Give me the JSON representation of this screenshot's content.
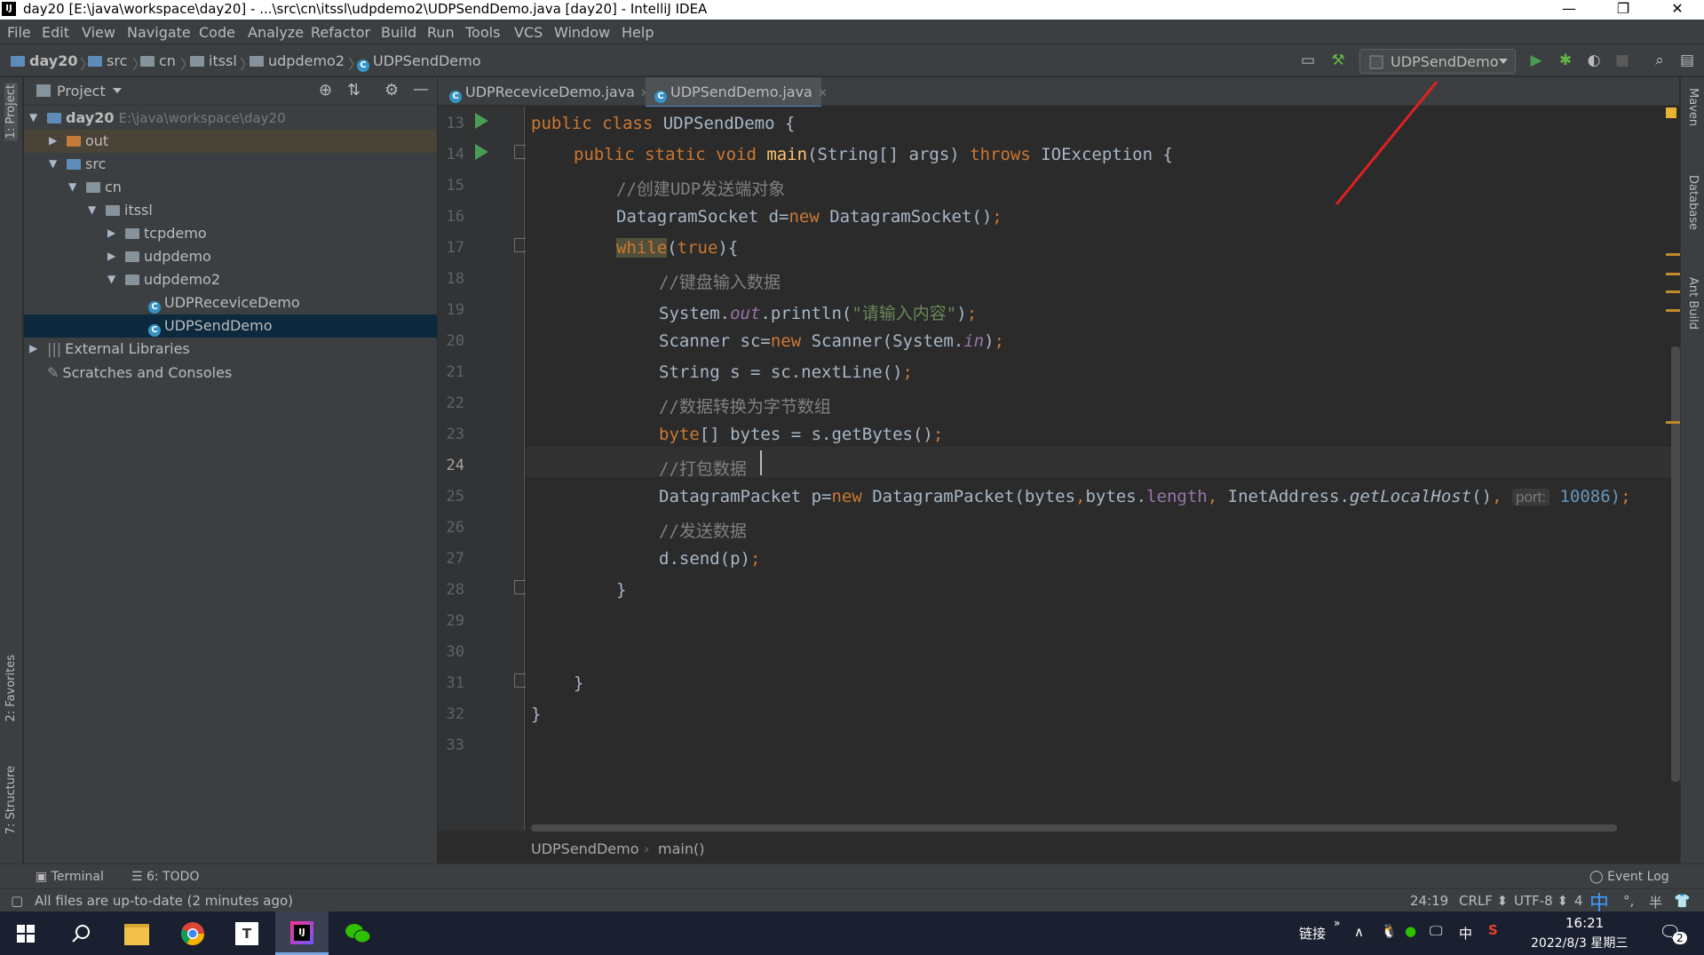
{
  "window": {
    "title": "day20 [E:\\java\\workspace\\day20] - ...\\src\\cn\\itssl\\udpdemo2\\UDPSendDemo.java [day20] - IntelliJ IDEA",
    "logo_text": "IJ",
    "minimize": "—",
    "restore": "❐",
    "close": "✕"
  },
  "menu": [
    "File",
    "Edit",
    "View",
    "Navigate",
    "Code",
    "Analyze",
    "Refactor",
    "Build",
    "Run",
    "Tools",
    "VCS",
    "Window",
    "Help"
  ],
  "navbar": {
    "crumbs": [
      "day20",
      "src",
      "cn",
      "itssl",
      "udpdemo2",
      "UDPSendDemo"
    ],
    "run_config": "UDPSendDemo"
  },
  "left_strip": {
    "project": "1: Project",
    "favorites": "2: Favorites",
    "structure": "7: Structure"
  },
  "right_strip": {
    "maven": "Maven",
    "database": "Database",
    "ant": "Ant Build"
  },
  "project_panel": {
    "title": "Project",
    "tree": [
      {
        "label": "day20",
        "path": "E:\\java\\workspace\\day20"
      },
      {
        "label": "out"
      },
      {
        "label": "src"
      },
      {
        "label": "cn"
      },
      {
        "label": "itssl"
      },
      {
        "label": "tcpdemo"
      },
      {
        "label": "udpdemo"
      },
      {
        "label": "udpdemo2"
      },
      {
        "label": "UDPReceviceDemo"
      },
      {
        "label": "UDPSendDemo"
      },
      {
        "label": "External Libraries"
      },
      {
        "label": "Scratches and Consoles"
      }
    ]
  },
  "tabs": [
    {
      "label": "UDPReceviceDemo.java"
    },
    {
      "label": "UDPSendDemo.java"
    }
  ],
  "editor": {
    "line_numbers": [
      "13",
      "14",
      "15",
      "16",
      "17",
      "18",
      "19",
      "20",
      "21",
      "22",
      "23",
      "24",
      "25",
      "26",
      "27",
      "28",
      "29",
      "30",
      "31",
      "32",
      "33"
    ],
    "current_line": "24",
    "t": {
      "l13a": "public class ",
      "l13b": "UDPSendDemo {",
      "l14a": "public static void ",
      "l14b": "main",
      "l14c": "(String[] args) ",
      "l14d": "throws ",
      "l14e": "IOException {",
      "l15": "//创建UDP发送端对象",
      "l16a": "DatagramSocket d=",
      "l16b": "new ",
      "l16c": "DatagramSocket()",
      "l16d": ";",
      "l17a": "while",
      "l17b": "(",
      "l17c": "true",
      "l17d": "){",
      "l18": "//键盘输入数据",
      "l19a": "System.",
      "l19b": "out",
      "l19c": ".println(",
      "l19d": "\"请输入内容\"",
      "l19e": ")",
      "l19f": ";",
      "l20a": "Scanner sc=",
      "l20b": "new ",
      "l20c": "Scanner(System.",
      "l20d": "in",
      "l20e": ")",
      "l20f": ";",
      "l21a": "String s = sc.nextLine()",
      "l21b": ";",
      "l22": "//数据转换为字节数组",
      "l23a": "byte",
      "l23b": "[] bytes = s.getBytes()",
      "l23c": ";",
      "l24": "//打包数据",
      "l25a": "DatagramPacket p=",
      "l25b": "new ",
      "l25c": "DatagramPacket(bytes",
      "l25d": ",",
      "l25e": "bytes.",
      "l25f": "length",
      "l25g": ", ",
      "l25h": "InetAddress.",
      "l25i": "getLocalHost",
      "l25j": "()",
      "l25k": ", ",
      "l25hint": "port:",
      "l25l": " 10086)",
      "l25m": ";",
      "l26": "//发送数据",
      "l27a": "d.send(p)",
      "l27b": ";",
      "l28": "}",
      "l31": "}",
      "l32": "}"
    }
  },
  "editor_breadcrumb": [
    "UDPSendDemo",
    "main()"
  ],
  "bottom_tabs": {
    "terminal": "Terminal",
    "todo": "6: TODO",
    "event_log": "Event Log"
  },
  "status": {
    "message": "All files are up-to-date (2 minutes ago)",
    "position": "24:19",
    "line_sep": "CRLF",
    "encoding": "UTF-8",
    "indent": "4"
  },
  "taskbar": {
    "link": "链接",
    "ime": "中",
    "time": "16:21",
    "date": "2022/8/3 星期三",
    "notifications": "2",
    "tray_extra": "半"
  },
  "colors": {
    "accent": "#4a88c7",
    "run_green": "#499c54",
    "annotation_red": "#e02020"
  }
}
